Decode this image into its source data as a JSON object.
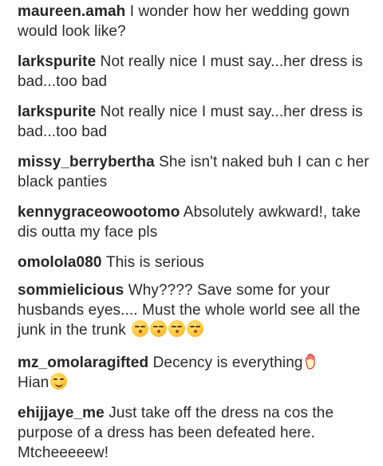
{
  "comments": [
    {
      "user": "maureen.amah",
      "text": "I wonder how her wedding gown would look like?"
    },
    {
      "user": "larkspurite",
      "text": "Not really nice I must say...her dress is bad...too bad"
    },
    {
      "user": "larkspurite",
      "text": "Not really nice I must say...her dress is bad...too bad"
    },
    {
      "user": "missy_berrybertha",
      "text": "She isn't naked buh I can c her black panties"
    },
    {
      "user": "kennygraceowootomo",
      "text": "Absolutely awkward!, take dis outta my face pls"
    },
    {
      "user": "omololа080",
      "text": "This is serious"
    },
    {
      "user": "sommielicious",
      "text": "Why???? Save some for your husbands eyes.... Must the whole world see all the junk in the trunk",
      "emojis": [
        "kissing-face-icon",
        "kissing-face-icon",
        "kissing-face-icon",
        "kissing-face-icon"
      ]
    },
    {
      "user": "mz_omolaragifted",
      "text": "Decency is everything",
      "text2": "Hian",
      "emojis": [
        "raised-hand-icon",
        "smirking-face-icon"
      ]
    },
    {
      "user": "ehijjaye_me",
      "text": "Just take off the dress na cos the purpose of a dress has been defeated here. Mtcheeeeew!"
    }
  ],
  "colors": {
    "username": "#262626",
    "text": "#2a2a2a",
    "emoji_yellow": "#ffc93a"
  }
}
